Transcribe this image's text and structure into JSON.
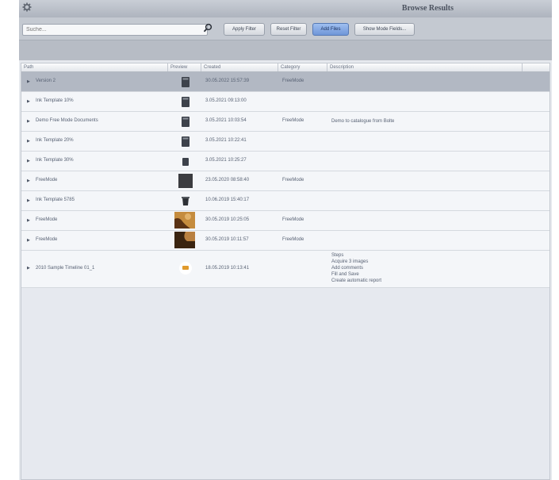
{
  "window": {
    "title": "Browse Results"
  },
  "icons": {
    "settings": "gear-icon",
    "search": "magnifier-icon"
  },
  "search": {
    "placeholder": "Suche...",
    "value": ""
  },
  "toolbar": {
    "apply_filter": "Apply Filter",
    "reset_filter": "Reset Filter",
    "add_files": "Add Files",
    "show_mode": "Show Mode Fields..."
  },
  "columns": {
    "path": "Path",
    "preview": "Preview",
    "created": "Created",
    "category": "Category",
    "description": "Description"
  },
  "rows": [
    {
      "path": "Version 2",
      "created": "30.05.2022 15:57:39",
      "category": "FreeMode",
      "description": "",
      "thumb": "doc"
    },
    {
      "path": "Ink Template 10%",
      "created": "3.05.2021 09:13:00",
      "category": "",
      "description": "",
      "thumb": "doc"
    },
    {
      "path": "Demo Free Mode Documents",
      "created": "3.05.2021 10:03:54",
      "category": "FreeMode",
      "description": "Demo to catalogue from Bolte",
      "thumb": "doc"
    },
    {
      "path": "Ink Template 20%",
      "created": "3.05.2021 10:22:41",
      "category": "",
      "description": "",
      "thumb": "doc"
    },
    {
      "path": "Ink Template 30%",
      "created": "3.05.2021 10:25:27",
      "category": "",
      "description": "",
      "thumb": "doc-small"
    },
    {
      "path": "FreeMode",
      "created": "23.05.2020 08:58:40",
      "category": "FreeMode",
      "description": "",
      "thumb": "dark"
    },
    {
      "path": "Ink Template 5785",
      "created": "10.06.2019 15:40:17",
      "category": "",
      "description": "",
      "thumb": "cup"
    },
    {
      "path": "FreeMode",
      "created": "30.05.2019 10:25:05",
      "category": "FreeMode",
      "description": "",
      "thumb": "photo1"
    },
    {
      "path": "FreeMode",
      "created": "30.05.2019 10:11:57",
      "category": "FreeMode",
      "description": "",
      "thumb": "photo2"
    },
    {
      "path": "2010 Sample Timeline 01_1",
      "created": "18.05.2019 10:13:41",
      "category": "",
      "description_lines": [
        "Steps",
        "Acquire 3 images",
        "Add comments",
        "Fill and Save",
        "Create automatic report"
      ],
      "thumb": "circle"
    }
  ]
}
